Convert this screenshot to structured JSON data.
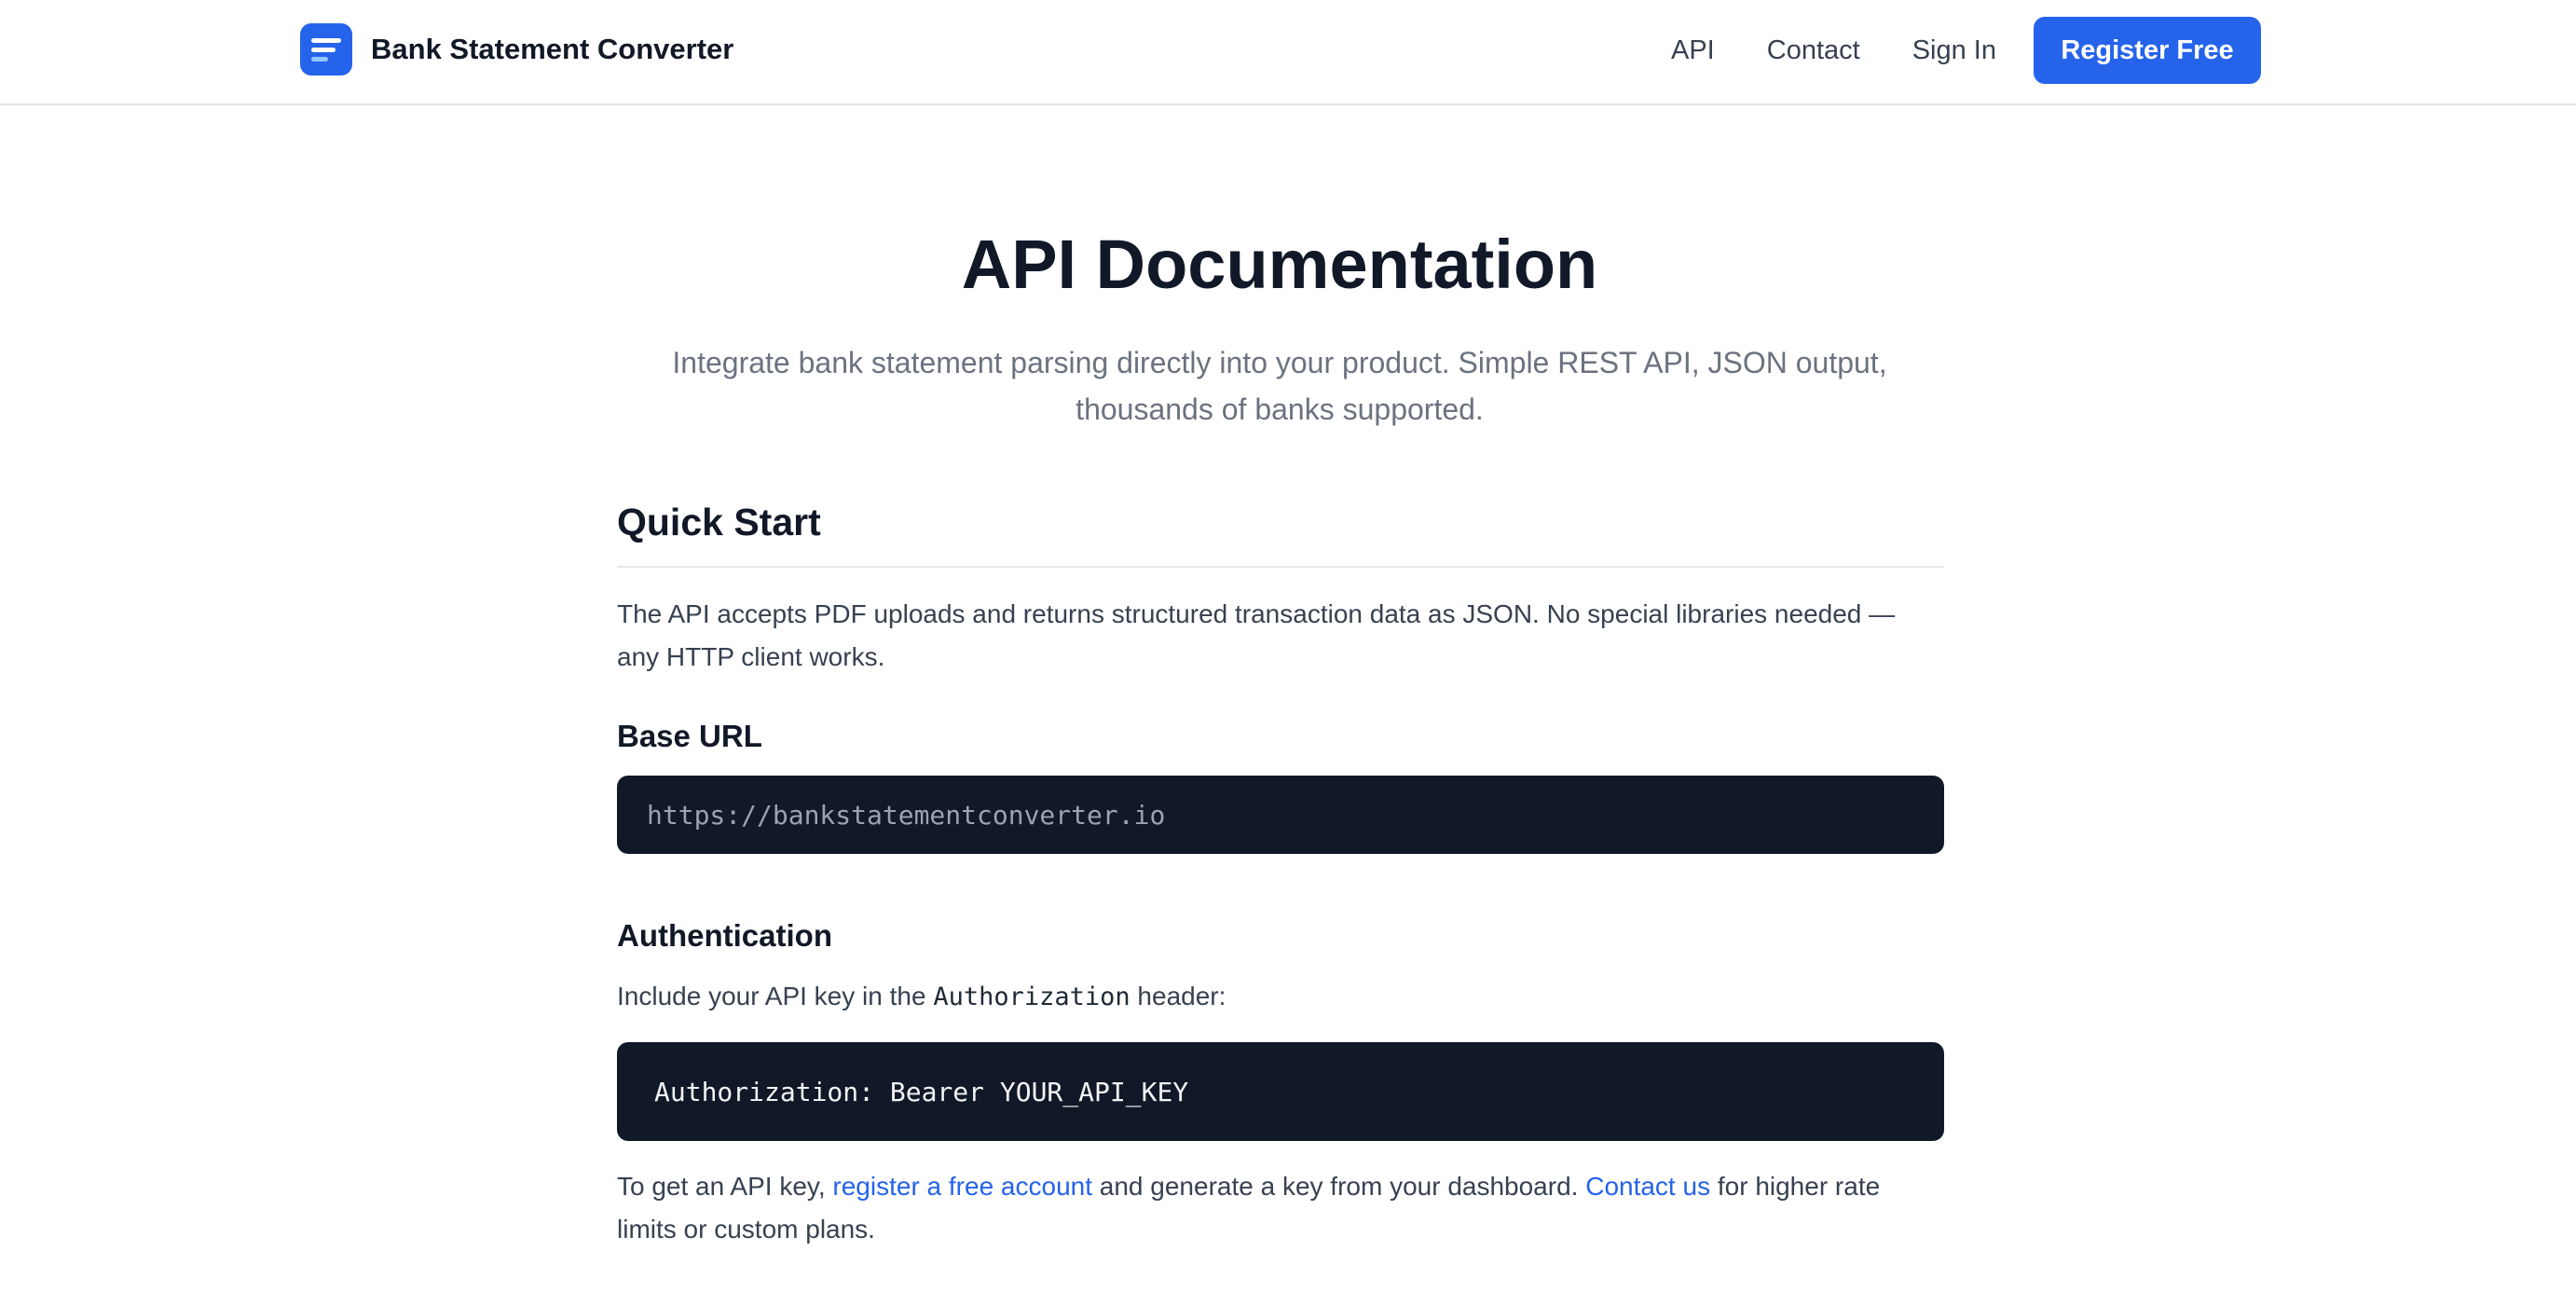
{
  "header": {
    "brand_name": "Bank Statement Converter",
    "logo_icon": "document-lines-icon",
    "nav": {
      "api": "API",
      "contact": "Contact",
      "sign_in": "Sign In"
    },
    "register_label": "Register Free"
  },
  "hero": {
    "title": "API Documentation",
    "subtitle_line1": "Integrate bank statement parsing directly into your product. Simple REST API, JSON output,",
    "subtitle_line2": "thousands of banks supported."
  },
  "quick_start": {
    "heading": "Quick Start",
    "intro_line1": "The API accepts PDF uploads and returns structured transaction data as JSON. No special libraries needed —",
    "intro_line2": "any HTTP client works.",
    "base_url_heading": "Base URL",
    "base_url": "https://bankstatementconverter.io",
    "auth_heading": "Authentication",
    "auth_text_before": "Include your API key in the ",
    "auth_header_name": "Authorization",
    "auth_text_after": " header:",
    "auth_example": "Authorization: Bearer YOUR_API_KEY",
    "key_text_1": "To get an API key, ",
    "key_link_register": "register a free account",
    "key_text_2": " and generate a key from your dashboard. ",
    "key_link_contact": "Contact us",
    "key_text_3": " for higher rate",
    "key_text_4": "limits or custom plans."
  },
  "colors": {
    "accent": "#2563eb",
    "code_background": "#111827",
    "muted_text": "#6b7280"
  }
}
